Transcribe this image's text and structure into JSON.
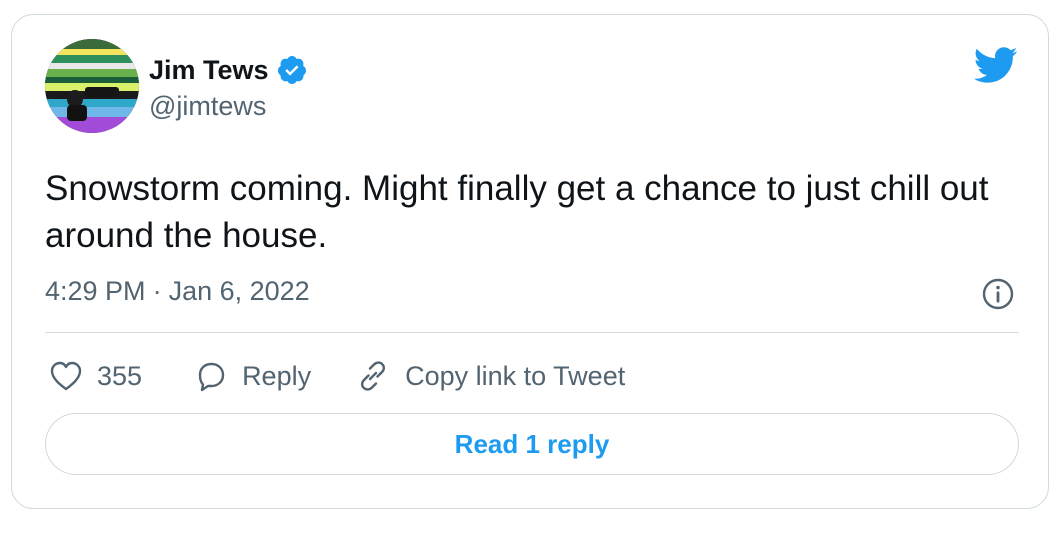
{
  "author": {
    "display_name": "Jim Tews",
    "handle": "@jimtews",
    "verified": true,
    "avatar_icon": "user-avatar-photo"
  },
  "brand": {
    "icon": "twitter-bird-icon",
    "color": "#1d9bf0"
  },
  "tweet": {
    "text": "Snowstorm coming. Might finally get a chance to just chill out around the house.",
    "time": "4:29 PM",
    "separator": "·",
    "date": "Jan 6, 2022"
  },
  "actions": {
    "like": {
      "icon": "heart-icon",
      "count": "355"
    },
    "reply": {
      "icon": "speech-bubble-icon",
      "label": "Reply"
    },
    "copy_link": {
      "icon": "link-icon",
      "label": "Copy link to Tweet"
    }
  },
  "info": {
    "icon": "info-icon"
  },
  "read_replies": {
    "label": "Read 1 reply"
  },
  "colors": {
    "text_primary": "#0f1419",
    "text_secondary": "#536471",
    "border": "#cfd9de",
    "accent": "#1d9bf0"
  }
}
